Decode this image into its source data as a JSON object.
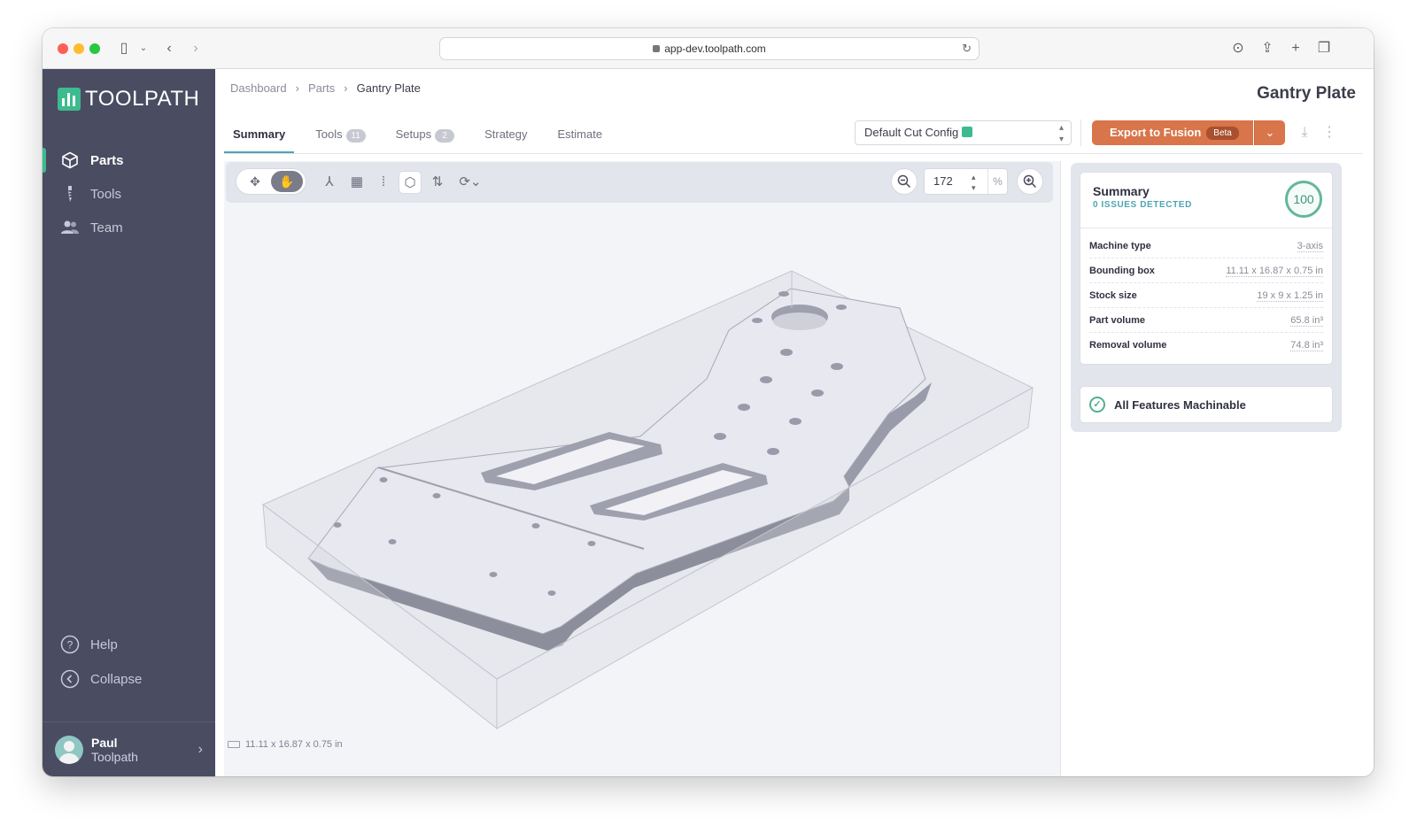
{
  "browser": {
    "url": "app-dev.toolpath.com"
  },
  "sidebar": {
    "logo_text": "TOOLPATH",
    "items": [
      {
        "label": "Parts",
        "icon": "cube-icon",
        "active": true
      },
      {
        "label": "Tools",
        "icon": "drill-bit-icon",
        "active": false
      },
      {
        "label": "Team",
        "icon": "people-icon",
        "active": false
      }
    ],
    "help_label": "Help",
    "collapse_label": "Collapse",
    "user": {
      "name": "Paul",
      "org": "Toolpath"
    }
  },
  "breadcrumb": [
    "Dashboard",
    "Parts",
    "Gantry Plate"
  ],
  "page_title": "Gantry Plate",
  "tabs": [
    {
      "label": "Summary",
      "count": ""
    },
    {
      "label": "Tools",
      "count": "11"
    },
    {
      "label": "Setups",
      "count": "2"
    },
    {
      "label": "Strategy",
      "count": ""
    },
    {
      "label": "Estimate",
      "count": ""
    }
  ],
  "config_select": {
    "value": "Default Cut Config"
  },
  "export": {
    "label": "Export to Fusion",
    "badge": "Beta"
  },
  "viewer": {
    "zoom_value": "172",
    "zoom_unit": "%",
    "dimensions": "11.11 x 16.87 x 0.75 in"
  },
  "summary": {
    "title": "Summary",
    "subtitle": "0 ISSUES DETECTED",
    "score": "100",
    "rows": [
      {
        "key": "Machine type",
        "value": "3-axis"
      },
      {
        "key": "Bounding box",
        "value": "11.11 x 16.87 x 0.75 in"
      },
      {
        "key": "Stock size",
        "value": "19 x 9 x 1.25 in"
      },
      {
        "key": "Part volume",
        "value": "65.8 in³"
      },
      {
        "key": "Removal volume",
        "value": "74.8 in³"
      }
    ],
    "machinable_label": "All Features Machinable"
  },
  "colors": {
    "sidebar": "#4a4c62",
    "accent": "#4fa3b3",
    "brand": "#3dbb8f",
    "export": "#d9754a"
  }
}
